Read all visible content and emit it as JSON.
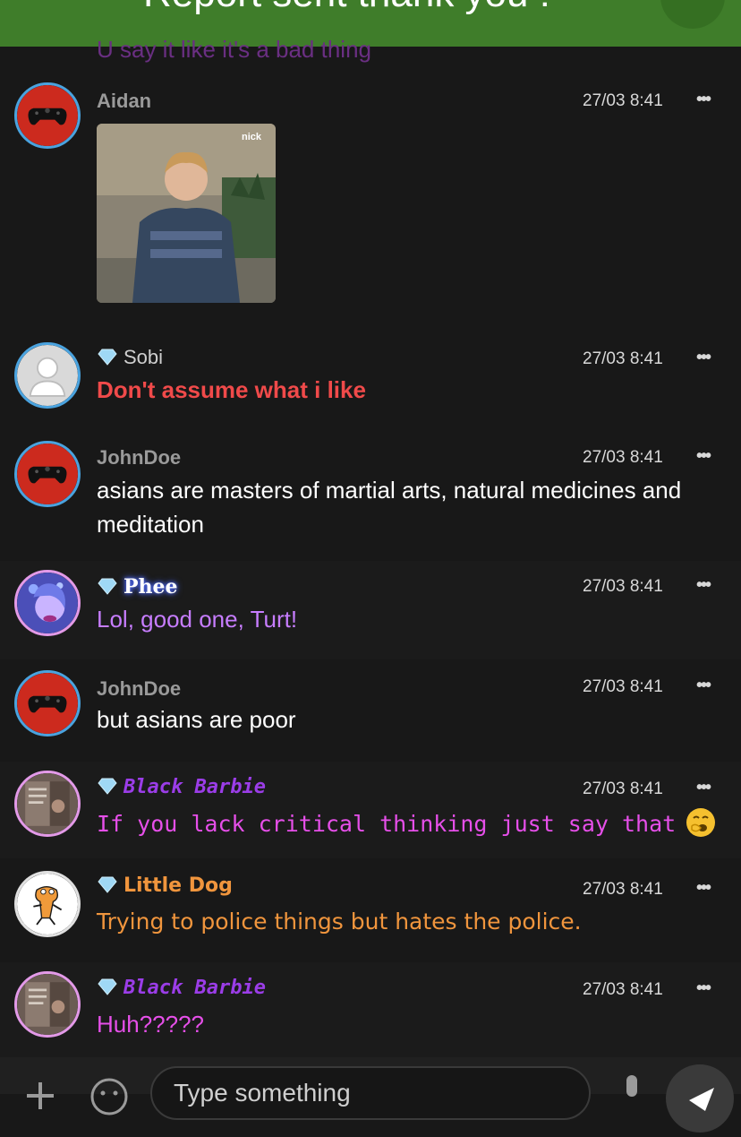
{
  "banner": {
    "text": "Report sent thank you !"
  },
  "previous_message": {
    "text": "U say it like it's a bad thing"
  },
  "messages": [
    {
      "name": "Aidan",
      "time": "27/03 8:41",
      "gif_label": "nick",
      "text": ""
    },
    {
      "name": "Sobi",
      "time": "27/03 8:41",
      "text": "Don't assume what i like"
    },
    {
      "name": "JohnDoe",
      "time": "27/03 8:41",
      "text": "asians are masters of martial arts, natural medicines and meditation"
    },
    {
      "name": "Phee",
      "time": "27/03 8:41",
      "text": "Lol, good one, Turt!"
    },
    {
      "name": "JohnDoe",
      "time": "27/03 8:41",
      "text": "but asians are poor"
    },
    {
      "name": "Black Barbie",
      "time": "27/03 8:41",
      "text": "If you lack critical thinking just say that"
    },
    {
      "name": "Little Dog",
      "time": "27/03 8:41",
      "text": "Trying to police things but hates the police."
    },
    {
      "name": "Black Barbie",
      "time": "27/03 8:41",
      "text": "Huh?????"
    }
  ],
  "more_label": "•••",
  "composer": {
    "placeholder": "Type something"
  },
  "icons": {
    "add": "plus-icon",
    "emoji": "smiley-icon",
    "mic": "microphone-icon",
    "send": "send-icon",
    "badge": "diamond-icon",
    "gamepad": "gamepad-icon"
  },
  "colors": {
    "banner": "#3f7d2a",
    "background": "#181818",
    "sobi_text": "#f04a4a",
    "phee_name": "#ffffff",
    "phee_text": "#c77dff",
    "barbie_name": "#9b3de8",
    "barbie_text": "#e64fe9",
    "dog_name": "#f0953d",
    "dog_text": "#f0953d",
    "timestamp": "#d8d8d8"
  }
}
